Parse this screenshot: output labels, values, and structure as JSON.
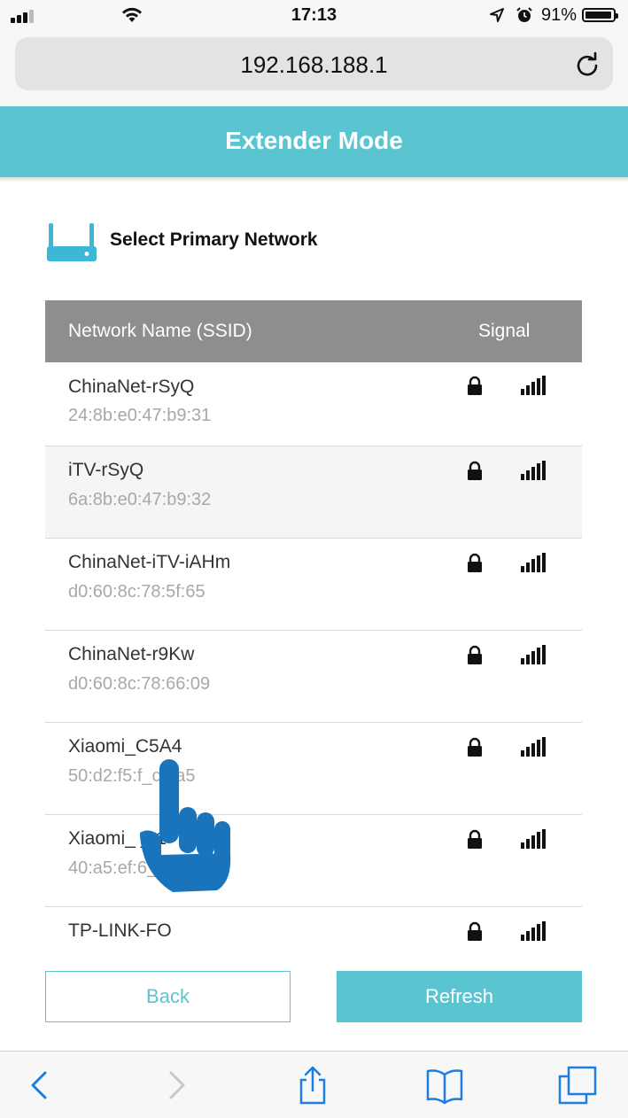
{
  "status_bar": {
    "time": "17:13",
    "battery_pct": "91%",
    "battery_level": 0.91
  },
  "browser": {
    "url": "192.168.188.1"
  },
  "header": {
    "title": "Extender Mode"
  },
  "section": {
    "title": "Select Primary Network"
  },
  "table": {
    "col_ssid": "Network Name (SSID)",
    "col_signal": "Signal",
    "rows": [
      {
        "ssid": "ChinaNet-rSyQ",
        "mac": "24:8b:e0:47:b9:31"
      },
      {
        "ssid": "iTV-rSyQ",
        "mac": "6a:8b:e0:47:b9:32"
      },
      {
        "ssid": "ChinaNet-iTV-iAHm",
        "mac": "d0:60:8c:78:5f:65"
      },
      {
        "ssid": "ChinaNet-r9Kw",
        "mac": "d0:60:8c:78:66:09"
      },
      {
        "ssid": "Xiaomi_C5A4",
        "mac": "50:d2:f5:f_c5:a5"
      },
      {
        "ssid": "Xiaomi_ _ 1",
        "mac": "40:a5:ef:6_ _0"
      },
      {
        "ssid": "TP-LINK-FO",
        "mac": ""
      }
    ]
  },
  "buttons": {
    "back": "Back",
    "refresh": "Refresh"
  },
  "colors": {
    "accent": "#5bc4d1",
    "table_header": "#8e8e8e",
    "hand": "#1a74bb"
  }
}
